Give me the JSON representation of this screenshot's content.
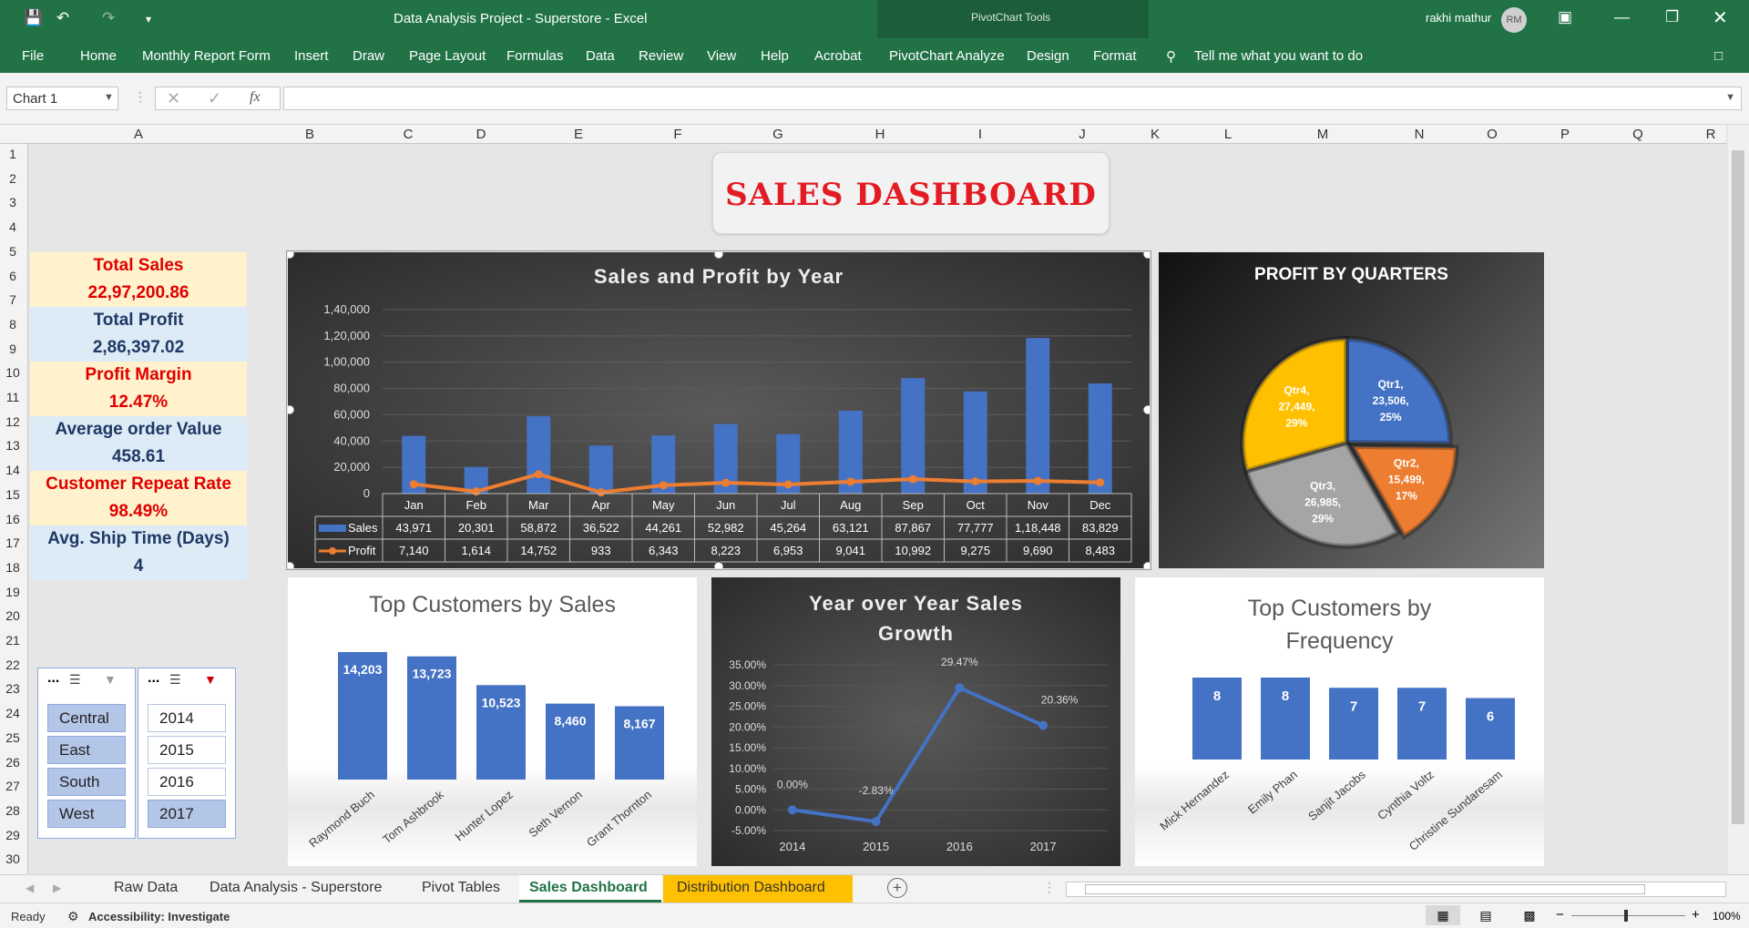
{
  "window": {
    "title": "Data Analysis Project - Superstore  -  Excel",
    "tools_label": "PivotChart Tools",
    "user": "rakhi mathur",
    "user_initials": "RM"
  },
  "ribbon_tabs": [
    "File",
    "Home",
    "Monthly Report Form",
    "Insert",
    "Draw",
    "Page Layout",
    "Formulas",
    "Data",
    "Review",
    "View",
    "Help",
    "Acrobat",
    "PivotChart Analyze",
    "Design",
    "Format"
  ],
  "tell_me": "Tell me what you want to do",
  "name_box": "Chart 1",
  "fx": "fx",
  "columns": [
    "A",
    "B",
    "C",
    "D",
    "E",
    "F",
    "G",
    "H",
    "I",
    "J",
    "K",
    "L",
    "M",
    "N",
    "O",
    "P",
    "Q",
    "R"
  ],
  "rows": [
    "1",
    "2",
    "3",
    "4",
    "5",
    "6",
    "7",
    "8",
    "9",
    "10",
    "11",
    "12",
    "13",
    "14",
    "15",
    "16",
    "17",
    "18",
    "19",
    "20",
    "21",
    "22",
    "23",
    "24",
    "25",
    "26",
    "27",
    "28",
    "29",
    "30"
  ],
  "dashboard_title": "SALES DASHBOARD",
  "kpis": [
    {
      "label": "Total Sales",
      "value": "22,97,200.86",
      "color": "#e00000",
      "bg": "#fff2cc"
    },
    {
      "label": "Total Profit",
      "value": "2,86,397.02",
      "color": "#1f3864",
      "bg": "#ddebf7"
    },
    {
      "label": "Profit Margin",
      "value": "12.47%",
      "color": "#e00000",
      "bg": "#fff2cc"
    },
    {
      "label": "Average order Value",
      "value": "458.61",
      "color": "#1f3864",
      "bg": "#ddebf7"
    },
    {
      "label": "Customer Repeat Rate",
      "value": "98.49%",
      "color": "#e00000",
      "bg": "#fff2cc"
    },
    {
      "label": "Avg. Ship Time (Days)",
      "value": "4",
      "color": "#1f3864",
      "bg": "#ddebf7"
    }
  ],
  "slicers": [
    {
      "header": "...",
      "items": [
        "Central",
        "East",
        "South",
        "West"
      ],
      "selected": [
        0,
        1,
        2,
        3
      ]
    },
    {
      "header": "...",
      "items": [
        "2014",
        "2015",
        "2016",
        "2017"
      ],
      "selected": [
        3
      ]
    }
  ],
  "sheet_tabs": [
    "Raw Data",
    "Data Analysis - Superstore",
    "Pivot Tables",
    "Sales Dashboard",
    "Distribution Dashboard"
  ],
  "active_sheet": "Sales Dashboard",
  "status": {
    "ready": "Ready",
    "accessibility": "Accessibility: Investigate",
    "zoom": "100%"
  },
  "chart_data": [
    {
      "type": "bar",
      "title": "Sales and Profit by Year",
      "categories": [
        "Jan",
        "Feb",
        "Mar",
        "Apr",
        "May",
        "Jun",
        "Jul",
        "Aug",
        "Sep",
        "Oct",
        "Nov",
        "Dec"
      ],
      "yticks": [
        "0",
        "20,000",
        "40,000",
        "60,000",
        "80,000",
        "1,00,000",
        "1,20,000",
        "1,40,000"
      ],
      "ylim": [
        0,
        140000
      ],
      "series": [
        {
          "name": "Sales",
          "kind": "bar",
          "values": [
            43971,
            20301,
            58872,
            36522,
            44261,
            52982,
            45264,
            63121,
            87867,
            77777,
            118448,
            83829
          ],
          "labels": [
            "43,971",
            "20,301",
            "58,872",
            "36,522",
            "44,261",
            "52,982",
            "45,264",
            "63,121",
            "87,867",
            "77,777",
            "1,18,448",
            "83,829"
          ]
        },
        {
          "name": "Profit",
          "kind": "line",
          "values": [
            7140,
            1614,
            14752,
            933,
            6343,
            8223,
            6953,
            9041,
            10992,
            9275,
            9690,
            8483
          ],
          "labels": [
            "7,140",
            "1,614",
            "14,752",
            "933",
            "6,343",
            "8,223",
            "6,953",
            "9,041",
            "10,992",
            "9,275",
            "9,690",
            "8,483"
          ]
        }
      ]
    },
    {
      "type": "pie",
      "title": "PROFIT BY QUARTERS",
      "slices": [
        {
          "name": "Qtr1",
          "value": 23506,
          "label": "23,506",
          "pct": "25%",
          "color": "#4472c4"
        },
        {
          "name": "Qtr2",
          "value": 15499,
          "label": "15,499",
          "pct": "17%",
          "color": "#ed7d31"
        },
        {
          "name": "Qtr3",
          "value": 26985,
          "label": "26,985",
          "pct": "29%",
          "color": "#a5a5a5"
        },
        {
          "name": "Qtr4",
          "value": 27449,
          "label": "27,449",
          "pct": "29%",
          "color": "#ffc000"
        }
      ]
    },
    {
      "type": "bar",
      "title": "Top Customers by Sales",
      "categories": [
        "Raymond Buch",
        "Tom Ashbrook",
        "Hunter Lopez",
        "Seth Vernon",
        "Grant Thornton"
      ],
      "values": [
        14203,
        13723,
        10523,
        8460,
        8167
      ],
      "labels": [
        "14,203",
        "13,723",
        "10,523",
        "8,460",
        "8,167"
      ]
    },
    {
      "type": "line",
      "title": "Year over Year Sales Growth",
      "categories": [
        "2014",
        "2015",
        "2016",
        "2017"
      ],
      "values": [
        0.0,
        -2.83,
        29.47,
        20.36
      ],
      "labels": [
        "0.00%",
        "-2.83%",
        "29.47%",
        "20.36%"
      ],
      "yticks": [
        "-5.00%",
        "0.00%",
        "5.00%",
        "10.00%",
        "15.00%",
        "20.00%",
        "25.00%",
        "30.00%",
        "35.00%"
      ],
      "ylim": [
        -5,
        35
      ]
    },
    {
      "type": "bar",
      "title": "Top Customers by Frequency",
      "categories": [
        "Mick Hernandez",
        "Emily Phan",
        "Sanjit Jacobs",
        "Cynthia Voltz",
        "Christine Sundaresam"
      ],
      "values": [
        8,
        8,
        7,
        7,
        6
      ],
      "labels": [
        "8",
        "8",
        "7",
        "7",
        "6"
      ]
    }
  ]
}
